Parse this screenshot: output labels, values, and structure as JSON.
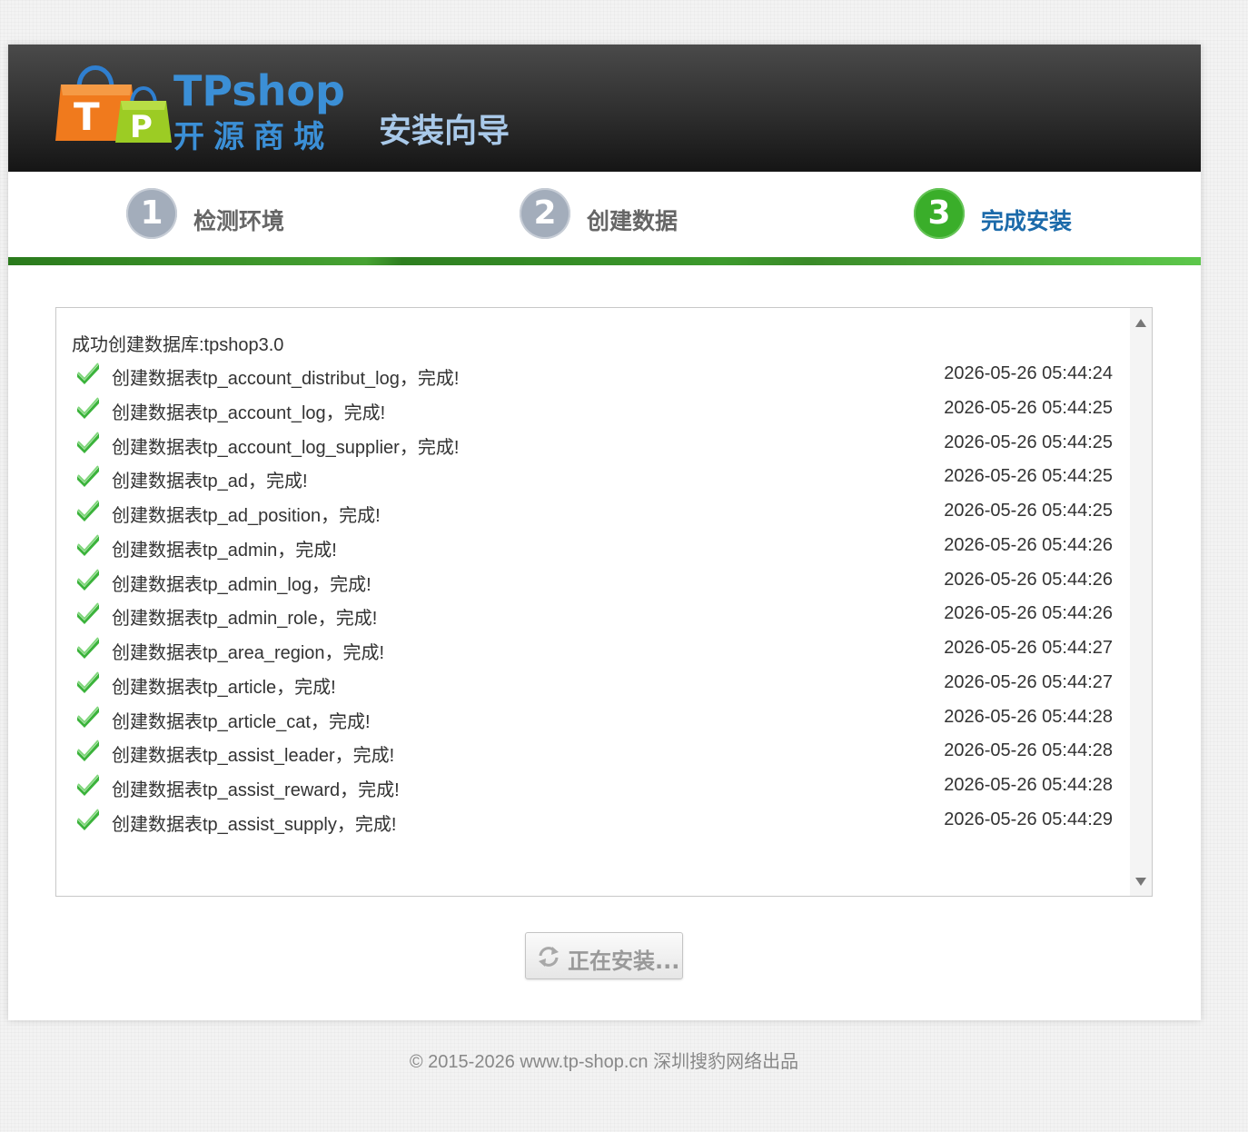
{
  "header": {
    "logo_text_en": "TPshop",
    "logo_text_cn": "开源商城",
    "wizard_title": "安装向导"
  },
  "steps": [
    {
      "number": "1",
      "label": "检测环境",
      "state": "done"
    },
    {
      "number": "2",
      "label": "创建数据",
      "state": "done"
    },
    {
      "number": "3",
      "label": "完成安装",
      "state": "active"
    }
  ],
  "log": {
    "db_line": "成功创建数据库:tpshop3.0",
    "entries": [
      {
        "message": "创建数据表tp_account_distribut_log，完成!",
        "time": "2026-05-26 05:44:24"
      },
      {
        "message": "创建数据表tp_account_log，完成!",
        "time": "2026-05-26 05:44:25"
      },
      {
        "message": "创建数据表tp_account_log_supplier，完成!",
        "time": "2026-05-26 05:44:25"
      },
      {
        "message": "创建数据表tp_ad，完成!",
        "time": "2026-05-26 05:44:25"
      },
      {
        "message": "创建数据表tp_ad_position，完成!",
        "time": "2026-05-26 05:44:25"
      },
      {
        "message": "创建数据表tp_admin，完成!",
        "time": "2026-05-26 05:44:26"
      },
      {
        "message": "创建数据表tp_admin_log，完成!",
        "time": "2026-05-26 05:44:26"
      },
      {
        "message": "创建数据表tp_admin_role，完成!",
        "time": "2026-05-26 05:44:26"
      },
      {
        "message": "创建数据表tp_area_region，完成!",
        "time": "2026-05-26 05:44:27"
      },
      {
        "message": "创建数据表tp_article，完成!",
        "time": "2026-05-26 05:44:27"
      },
      {
        "message": "创建数据表tp_article_cat，完成!",
        "time": "2026-05-26 05:44:28"
      },
      {
        "message": "创建数据表tp_assist_leader，完成!",
        "time": "2026-05-26 05:44:28"
      },
      {
        "message": "创建数据表tp_assist_reward，完成!",
        "time": "2026-05-26 05:44:28"
      },
      {
        "message": "创建数据表tp_assist_supply，完成!",
        "time": "2026-05-26 05:44:29"
      }
    ]
  },
  "install_button": {
    "label": "正在安装...",
    "icon": "refresh-icon"
  },
  "footer": {
    "text": "© 2015-2026 www.tp-shop.cn 深圳搜豹网络出品"
  },
  "colors": {
    "header_bg": "#2e2e2e",
    "brand_blue": "#3b8fd6",
    "step_active_green": "#3aae2a",
    "step_inactive_grey": "#a3adbb",
    "check_green": "#3bb33b"
  }
}
